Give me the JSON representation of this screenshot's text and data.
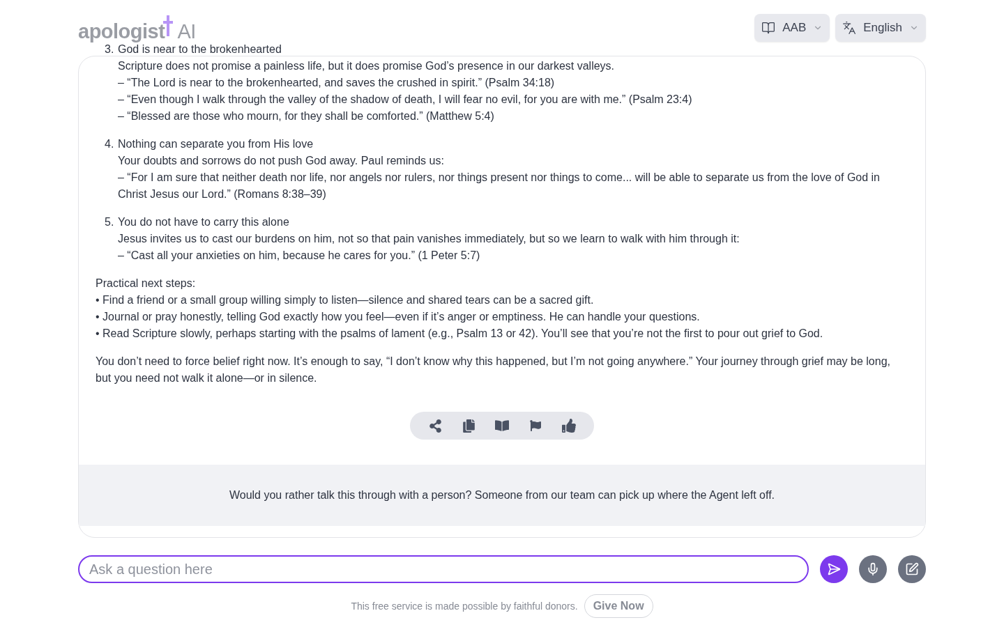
{
  "header": {
    "logo": {
      "word": "apologist",
      "suffix": "AI"
    },
    "bible_menu": {
      "label": "AAB"
    },
    "language_menu": {
      "label": "English"
    }
  },
  "answer": {
    "points": [
      {
        "number": "3.",
        "title": "God is near to the brokenhearted",
        "lines": [
          "Scripture does not promise a painless life, but it does promise God’s presence in our darkest valleys.",
          "– “The Lord is near to the brokenhearted, and saves the crushed in spirit.” (Psalm 34:18)",
          "– “Even though I walk through the valley of the shadow of death, I will fear no evil, for you are with me.” (Psalm 23:4)",
          "– “Blessed are those who mourn, for they shall be comforted.” (Matthew 5:4)"
        ]
      },
      {
        "number": "4.",
        "title": "Nothing can separate you from His love",
        "lines": [
          "Your doubts and sorrows do not push God away. Paul reminds us:",
          "– “For I am sure that neither death nor life, nor angels nor rulers, nor things present nor things to come... will be able to separate us from the love of God in Christ Jesus our Lord.” (Romans 8:38–39)"
        ]
      },
      {
        "number": "5.",
        "title": "You do not have to carry this alone",
        "lines": [
          "Jesus invites us to cast our burdens on him, not so that pain vanishes immediately, but so we learn to walk with him through it:",
          "– “Cast all your anxieties on him, because he cares for you.” (1 Peter 5:7)"
        ]
      }
    ],
    "steps_heading": "Practical next steps:",
    "steps": [
      "• Find a friend or a small group willing simply to listen—silence and shared tears can be a sacred gift.",
      "• Journal or pray honestly, telling God exactly how you feel—even if it’s anger or emptiness. He can handle your questions.",
      "• Read Scripture slowly, perhaps starting with the psalms of lament (e.g., Psalm 13 or 42). You’ll see that you’re not the first to pour out grief to God."
    ],
    "closing": "You don’t need to force belief right now. It’s enough to say, “I don’t know why this happened, but I’m not going anywhere.” Your journey through grief may be long, but you need not walk it alone—or in silence.",
    "actions": [
      {
        "kind": "share"
      },
      {
        "kind": "copy"
      },
      {
        "kind": "book"
      },
      {
        "kind": "flag"
      },
      {
        "kind": "like"
      }
    ]
  },
  "handoff": {
    "text": "Would you rather talk this through with a person? Someone from our team can pick up where the Agent left off."
  },
  "composer": {
    "placeholder": "Ask a question here",
    "buttons": [
      {
        "kind": "send"
      },
      {
        "kind": "mic"
      },
      {
        "kind": "new"
      }
    ]
  },
  "footer": {
    "text": "This free service is made possible by faithful donors.",
    "button": "Give Now"
  }
}
